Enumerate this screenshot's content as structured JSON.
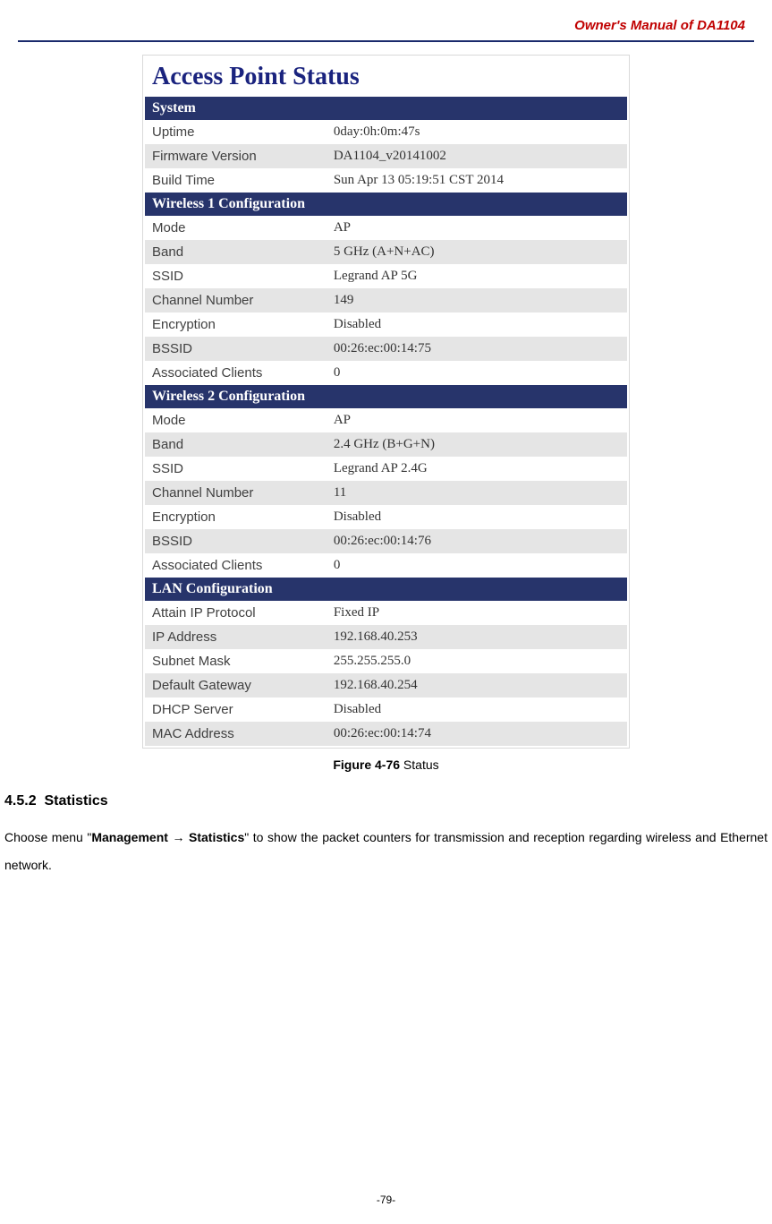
{
  "header": {
    "title": "Owner's Manual of DA1104"
  },
  "screenshot": {
    "title": "Access Point Status",
    "sections": [
      {
        "name": "System",
        "rows": [
          {
            "label": "Uptime",
            "value": "0day:0h:0m:47s"
          },
          {
            "label": "Firmware Version",
            "value": "DA1104_v20141002"
          },
          {
            "label": "Build Time",
            "value": "Sun Apr 13 05:19:51 CST 2014"
          }
        ]
      },
      {
        "name": "Wireless 1 Configuration",
        "rows": [
          {
            "label": "Mode",
            "value": "AP"
          },
          {
            "label": "Band",
            "value": "5 GHz (A+N+AC)"
          },
          {
            "label": "SSID",
            "value": "Legrand AP 5G"
          },
          {
            "label": "Channel Number",
            "value": "149"
          },
          {
            "label": "Encryption",
            "value": "Disabled"
          },
          {
            "label": "BSSID",
            "value": "00:26:ec:00:14:75"
          },
          {
            "label": "Associated Clients",
            "value": "0"
          }
        ]
      },
      {
        "name": "Wireless 2 Configuration",
        "rows": [
          {
            "label": "Mode",
            "value": "AP"
          },
          {
            "label": "Band",
            "value": "2.4 GHz (B+G+N)"
          },
          {
            "label": "SSID",
            "value": "Legrand AP 2.4G"
          },
          {
            "label": "Channel Number",
            "value": "11"
          },
          {
            "label": "Encryption",
            "value": "Disabled"
          },
          {
            "label": "BSSID",
            "value": "00:26:ec:00:14:76"
          },
          {
            "label": "Associated Clients",
            "value": "0"
          }
        ]
      },
      {
        "name": "LAN Configuration",
        "rows": [
          {
            "label": "Attain IP Protocol",
            "value": "Fixed IP"
          },
          {
            "label": "IP Address",
            "value": "192.168.40.253"
          },
          {
            "label": "Subnet Mask",
            "value": "255.255.255.0"
          },
          {
            "label": "Default Gateway",
            "value": "192.168.40.254"
          },
          {
            "label": "DHCP Server",
            "value": "Disabled"
          },
          {
            "label": "MAC Address",
            "value": "00:26:ec:00:14:74"
          }
        ]
      }
    ]
  },
  "figure_caption": {
    "bold": "Figure 4-76",
    "rest": " Status"
  },
  "section": {
    "number": "4.5.2",
    "title": "Statistics",
    "body_pre": "Choose menu \"",
    "body_bold": "Management → Statistics",
    "body_post": "\" to show the packet counters for transmission and reception regarding wireless and Ethernet network."
  },
  "page_number": "-79-"
}
